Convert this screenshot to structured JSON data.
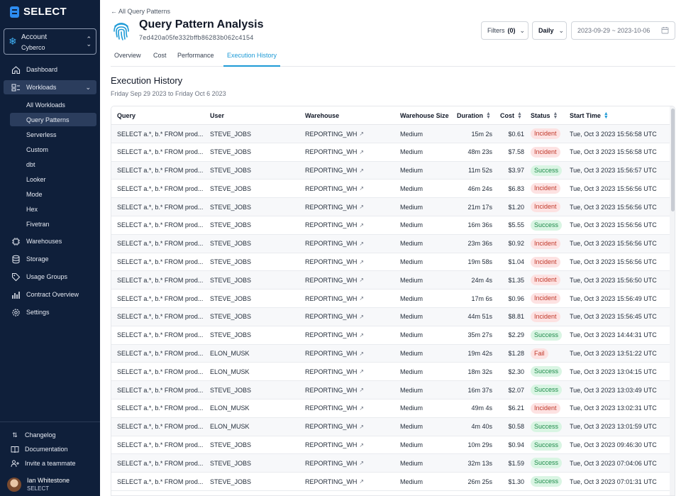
{
  "brand": {
    "name": "SELECT"
  },
  "account": {
    "label": "Account",
    "value": "Cyberco"
  },
  "nav": {
    "dashboard": "Dashboard",
    "workloads": "Workloads",
    "sub": [
      "All Workloads",
      "Query Patterns",
      "Serverless",
      "Custom",
      "dbt",
      "Looker",
      "Mode",
      "Hex",
      "Fivetran"
    ],
    "warehouses": "Warehouses",
    "storage": "Storage",
    "usage_groups": "Usage Groups",
    "contract": "Contract Overview",
    "settings": "Settings"
  },
  "footer": {
    "changelog": "Changelog",
    "documentation": "Documentation",
    "invite": "Invite a teammate",
    "user_name": "Ian Whitestone",
    "user_org": "SELECT"
  },
  "header": {
    "back": "← All Query Patterns",
    "title": "Query Pattern Analysis",
    "hash": "7ed420a05fe332bffb86283b062c4154",
    "filters_label": "Filters",
    "filters_count": "(0)",
    "granularity": "Daily",
    "date_range": "2023-09-29 ~ 2023-10-06"
  },
  "tabs": [
    "Overview",
    "Cost",
    "Performance",
    "Execution History"
  ],
  "section": {
    "title": "Execution History",
    "subtitle": "Friday Sep 29 2023 to Friday Oct 6 2023"
  },
  "table": {
    "columns": [
      "Query",
      "User",
      "Warehouse",
      "Warehouse Size",
      "Duration",
      "Cost",
      "Status",
      "Start Time"
    ],
    "rows": [
      [
        "SELECT a.*, b.* FROM prod...",
        "STEVE_JOBS",
        "REPORTING_WH",
        "Medium",
        "15m 2s",
        "$0.61",
        "Incident",
        "Tue, Oct 3 2023 15:56:58 UTC"
      ],
      [
        "SELECT a.*, b.* FROM prod...",
        "STEVE_JOBS",
        "REPORTING_WH",
        "Medium",
        "48m 23s",
        "$7.58",
        "Incident",
        "Tue, Oct 3 2023 15:56:58 UTC"
      ],
      [
        "SELECT a.*, b.* FROM prod...",
        "STEVE_JOBS",
        "REPORTING_WH",
        "Medium",
        "11m 52s",
        "$3.97",
        "Success",
        "Tue, Oct 3 2023 15:56:57 UTC"
      ],
      [
        "SELECT a.*, b.* FROM prod...",
        "STEVE_JOBS",
        "REPORTING_WH",
        "Medium",
        "46m 24s",
        "$6.83",
        "Incident",
        "Tue, Oct 3 2023 15:56:56 UTC"
      ],
      [
        "SELECT a.*, b.* FROM prod...",
        "STEVE_JOBS",
        "REPORTING_WH",
        "Medium",
        "21m 17s",
        "$1.20",
        "Incident",
        "Tue, Oct 3 2023 15:56:56 UTC"
      ],
      [
        "SELECT a.*, b.* FROM prod...",
        "STEVE_JOBS",
        "REPORTING_WH",
        "Medium",
        "16m 36s",
        "$5.55",
        "Success",
        "Tue, Oct 3 2023 15:56:56 UTC"
      ],
      [
        "SELECT a.*, b.* FROM prod...",
        "STEVE_JOBS",
        "REPORTING_WH",
        "Medium",
        "23m 36s",
        "$0.92",
        "Incident",
        "Tue, Oct 3 2023 15:56:56 UTC"
      ],
      [
        "SELECT a.*, b.* FROM prod...",
        "STEVE_JOBS",
        "REPORTING_WH",
        "Medium",
        "19m 58s",
        "$1.04",
        "Incident",
        "Tue, Oct 3 2023 15:56:56 UTC"
      ],
      [
        "SELECT a.*, b.* FROM prod...",
        "STEVE_JOBS",
        "REPORTING_WH",
        "Medium",
        "24m 4s",
        "$1.35",
        "Incident",
        "Tue, Oct 3 2023 15:56:50 UTC"
      ],
      [
        "SELECT a.*, b.* FROM prod...",
        "STEVE_JOBS",
        "REPORTING_WH",
        "Medium",
        "17m 6s",
        "$0.96",
        "Incident",
        "Tue, Oct 3 2023 15:56:49 UTC"
      ],
      [
        "SELECT a.*, b.* FROM prod...",
        "STEVE_JOBS",
        "REPORTING_WH",
        "Medium",
        "44m 51s",
        "$8.81",
        "Incident",
        "Tue, Oct 3 2023 15:56:45 UTC"
      ],
      [
        "SELECT a.*, b.* FROM prod...",
        "STEVE_JOBS",
        "REPORTING_WH",
        "Medium",
        "35m 27s",
        "$2.29",
        "Success",
        "Tue, Oct 3 2023 14:44:31 UTC"
      ],
      [
        "SELECT a.*, b.* FROM prod...",
        "ELON_MUSK",
        "REPORTING_WH",
        "Medium",
        "19m 42s",
        "$1.28",
        "Fail",
        "Tue, Oct 3 2023 13:51:22 UTC"
      ],
      [
        "SELECT a.*, b.* FROM prod...",
        "ELON_MUSK",
        "REPORTING_WH",
        "Medium",
        "18m 32s",
        "$2.30",
        "Success",
        "Tue, Oct 3 2023 13:04:15 UTC"
      ],
      [
        "SELECT a.*, b.* FROM prod...",
        "STEVE_JOBS",
        "REPORTING_WH",
        "Medium",
        "16m 37s",
        "$2.07",
        "Success",
        "Tue, Oct 3 2023 13:03:49 UTC"
      ],
      [
        "SELECT a.*, b.* FROM prod...",
        "ELON_MUSK",
        "REPORTING_WH",
        "Medium",
        "49m 4s",
        "$6.21",
        "Incident",
        "Tue, Oct 3 2023 13:02:31 UTC"
      ],
      [
        "SELECT a.*, b.* FROM prod...",
        "ELON_MUSK",
        "REPORTING_WH",
        "Medium",
        "4m 40s",
        "$0.58",
        "Success",
        "Tue, Oct 3 2023 13:01:59 UTC"
      ],
      [
        "SELECT a.*, b.* FROM prod...",
        "STEVE_JOBS",
        "REPORTING_WH",
        "Medium",
        "10m 29s",
        "$0.94",
        "Success",
        "Tue, Oct 3 2023 09:46:30 UTC"
      ],
      [
        "SELECT a.*, b.* FROM prod...",
        "STEVE_JOBS",
        "REPORTING_WH",
        "Medium",
        "32m 13s",
        "$1.59",
        "Success",
        "Tue, Oct 3 2023 07:04:06 UTC"
      ],
      [
        "SELECT a.*, b.* FROM prod...",
        "STEVE_JOBS",
        "REPORTING_WH",
        "Medium",
        "26m 25s",
        "$1.30",
        "Success",
        "Tue, Oct 3 2023 07:01:31 UTC"
      ]
    ]
  },
  "colors": {
    "sidebar": "#0f1f3a",
    "accent": "#1d9ad6",
    "incident": "#c0392b",
    "success": "#1e8a4a"
  }
}
